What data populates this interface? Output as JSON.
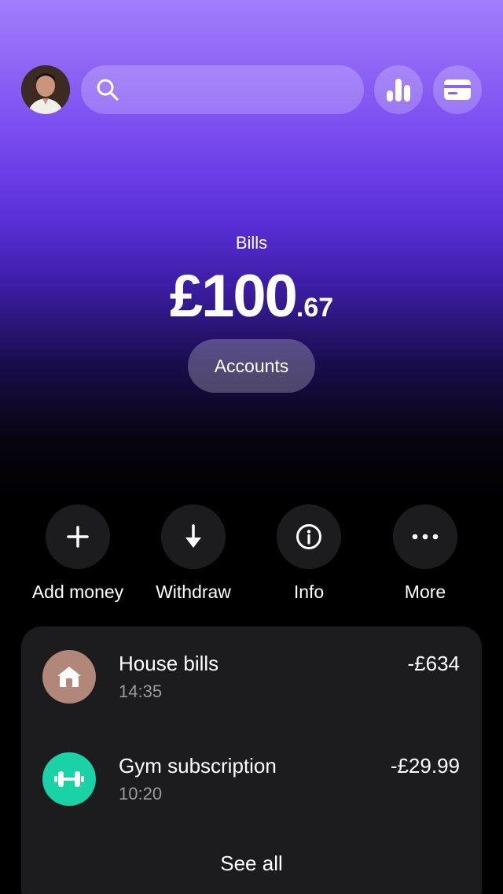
{
  "header": {
    "avatar_icon": "user-avatar",
    "search": {
      "placeholder": "",
      "icon": "search-icon"
    },
    "stats_icon": "bar-chart-icon",
    "card_icon": "credit-card-icon"
  },
  "balance": {
    "account_name": "Bills",
    "amount_main": "£100",
    "amount_cents": ".67",
    "accounts_button": "Accounts"
  },
  "actions": [
    {
      "label": "Add money",
      "icon": "plus-icon"
    },
    {
      "label": "Withdraw",
      "icon": "arrow-down-icon"
    },
    {
      "label": "Info",
      "icon": "info-icon"
    },
    {
      "label": "More",
      "icon": "more-icon"
    }
  ],
  "transactions": [
    {
      "title": "House bills",
      "time": "14:35",
      "amount": "-£634",
      "icon": "house-icon",
      "icon_bg": "#b08778"
    },
    {
      "title": "Gym subscription",
      "time": "10:20",
      "amount": "-£29.99",
      "icon": "dumbbell-icon",
      "icon_bg": "#19d3a6"
    }
  ],
  "see_all_label": "See all",
  "colors": {
    "accent_top": "#a27dfb",
    "accent_mid": "#5a2fd8",
    "background": "#000000",
    "card": "#1c1c1e"
  }
}
